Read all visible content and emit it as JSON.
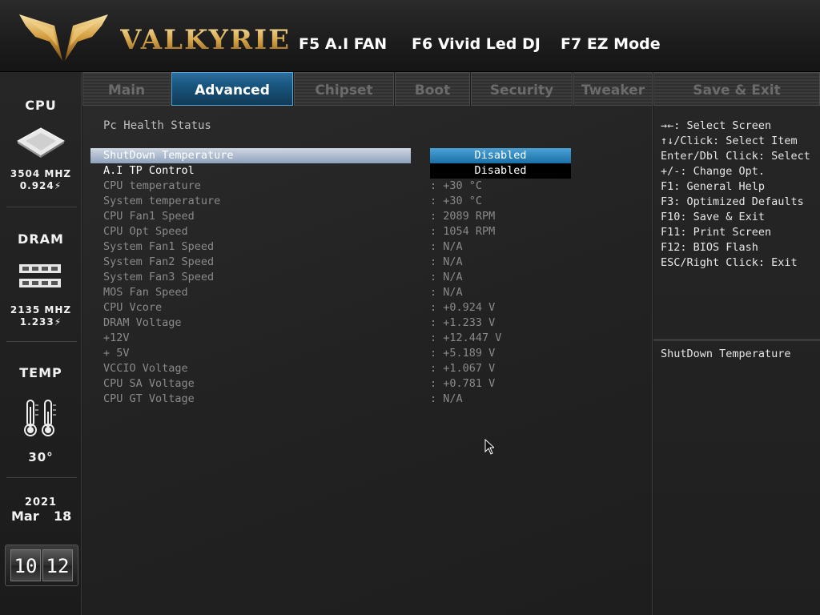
{
  "header": {
    "brand": "VALKYRIE",
    "hotkeys": [
      "F5 A.I FAN",
      "F6 Vivid Led DJ",
      "F7 EZ Mode"
    ]
  },
  "sidebar": {
    "cpu": {
      "label": "CPU",
      "freq": "3504 MHZ",
      "volt": "0.924⚡",
      "icon": "cpu-chip-icon"
    },
    "dram": {
      "label": "DRAM",
      "freq": "2135 MHZ",
      "volt": "1.233⚡",
      "icon": "memory-module-icon"
    },
    "temp": {
      "label": "TEMP",
      "value": "30°",
      "icon": "thermometer-icon"
    },
    "date": {
      "year": "2021",
      "month": "Mar",
      "day": "18"
    },
    "clock": {
      "hour": "10",
      "minute": "12"
    }
  },
  "tabs": [
    "Main",
    "Advanced",
    "Chipset",
    "Boot",
    "Security",
    "Tweaker",
    "Save & Exit"
  ],
  "active_tab": "Advanced",
  "main": {
    "section_title": "Pc Health Status",
    "shutdown": {
      "label": "ShutDown Temperature",
      "value": "Disabled"
    },
    "aitp": {
      "label": "A.I TP Control",
      "value": "Disabled"
    },
    "readings": [
      {
        "label": "CPU temperature",
        "value": ": +30  °C"
      },
      {
        "label": "System temperature",
        "value": ": +30  °C"
      },
      {
        "label": "CPU Fan1 Speed",
        "value": ": 2089 RPM"
      },
      {
        "label": "CPU Opt Speed",
        "value": ": 1054 RPM"
      },
      {
        "label": "System Fan1 Speed",
        "value": ": N/A"
      },
      {
        "label": "System Fan2 Speed",
        "value": ": N/A"
      },
      {
        "label": "System Fan3 Speed",
        "value": ": N/A"
      },
      {
        "label": "MOS Fan Speed",
        "value": ": N/A"
      },
      {
        "label": "CPU Vcore",
        "value": ": +0.924 V"
      },
      {
        "label": "DRAM Voltage",
        "value": ": +1.233 V"
      },
      {
        "label": "+12V",
        "value": ": +12.447 V"
      },
      {
        "label": "+ 5V",
        "value": ": +5.189 V"
      },
      {
        "label": "VCCIO Voltage",
        "value": ": +1.067 V"
      },
      {
        "label": "CPU SA Voltage",
        "value": ": +0.781 V"
      },
      {
        "label": "CPU GT Voltage",
        "value": ": N/A"
      }
    ]
  },
  "help": {
    "keys": [
      "→←: Select Screen",
      "↑↓/Click: Select Item",
      "Enter/Dbl Click: Select",
      "+/-: Change Opt.",
      "F1: General Help",
      "F3: Optimized Defaults",
      "F10: Save & Exit",
      "F11: Print Screen",
      "F12: BIOS Flash",
      "ESC/Right Click: Exit"
    ],
    "description": "ShutDown Temperature"
  },
  "colors": {
    "accent": "#1a6fa6",
    "selection_bar": "#8ea2bd",
    "brand_gold": "#d6a54a"
  }
}
